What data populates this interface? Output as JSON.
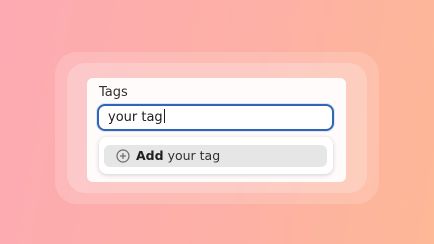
{
  "field": {
    "label": "Tags",
    "value": "your tag"
  },
  "suggestion": {
    "icon": "plus-circle-icon",
    "action": "Add",
    "value": "your tag"
  },
  "colors": {
    "background_start": "#fdaab2",
    "background_end": "#fdb896",
    "focus_border": "#2f66b8",
    "option_highlight": "#e6e6e6"
  }
}
